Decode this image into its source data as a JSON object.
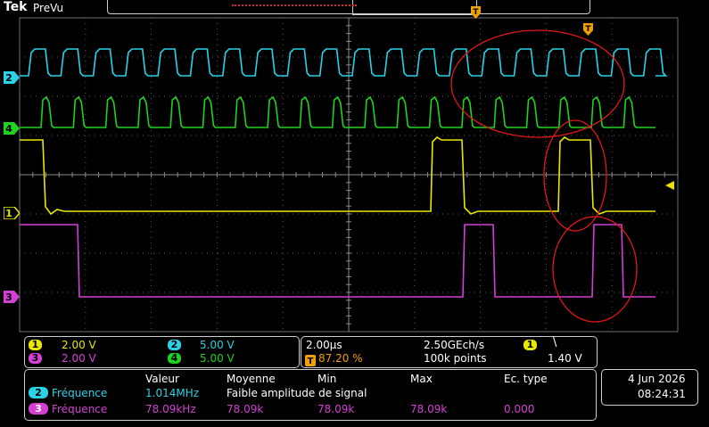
{
  "header": {
    "brand": "Tek",
    "mode": "PreVu"
  },
  "channels": [
    {
      "id": "1",
      "scale": "2.00 V",
      "color": "#e8e800"
    },
    {
      "id": "2",
      "scale": "5.00 V",
      "color": "#29d2e6"
    },
    {
      "id": "3",
      "scale": "2.00 V",
      "color": "#d43fd4"
    },
    {
      "id": "4",
      "scale": "5.00 V",
      "color": "#1fd21f"
    }
  ],
  "acquisition": {
    "timebase": "2.00µs",
    "sample_rate": "2.50GEch/s",
    "trigger_position": "87.20 %",
    "record_length": "100k points",
    "trigger_channel": "1",
    "trigger_slope_glyph": "\\",
    "trigger_level": "1.40 V"
  },
  "measurements": {
    "headers": [
      "Valeur",
      "Moyenne",
      "Min",
      "Max",
      "Ec. type"
    ],
    "rows": [
      {
        "channel": "2",
        "name": "Fréquence",
        "value": "1.014MHz",
        "mean": "Faible amplitude de signal",
        "min": "",
        "max": "",
        "stddev": ""
      },
      {
        "channel": "3",
        "name": "Fréquence",
        "value": "78.09kHz",
        "mean": "78.09k",
        "min": "78.09k",
        "max": "78.09k",
        "stddev": "0.000"
      }
    ]
  },
  "datetime": {
    "date": "4 Jun  2026",
    "time": "08:24:31"
  },
  "markers": {
    "trigger_glyph": "T"
  }
}
